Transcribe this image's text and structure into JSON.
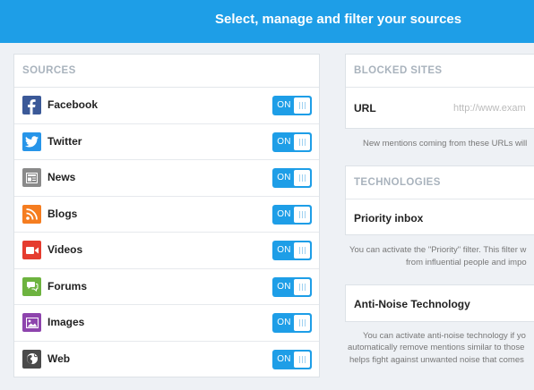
{
  "header": {
    "title": "Select, manage and filter your sources"
  },
  "sources": {
    "heading": "SOURCES",
    "items": [
      {
        "label": "Facebook",
        "icon": "facebook-icon",
        "color": "#3b5998",
        "state": "ON"
      },
      {
        "label": "Twitter",
        "icon": "twitter-icon",
        "color": "#2795e9",
        "state": "ON"
      },
      {
        "label": "News",
        "icon": "news-icon",
        "color": "#8a8a8a",
        "state": "ON"
      },
      {
        "label": "Blogs",
        "icon": "blogs-icon",
        "color": "#f57d20",
        "state": "ON"
      },
      {
        "label": "Videos",
        "icon": "videos-icon",
        "color": "#e53c2f",
        "state": "ON"
      },
      {
        "label": "Forums",
        "icon": "forums-icon",
        "color": "#6db33f",
        "state": "ON"
      },
      {
        "label": "Images",
        "icon": "images-icon",
        "color": "#8e44ad",
        "state": "ON"
      },
      {
        "label": "Web",
        "icon": "web-icon",
        "color": "#4a4a4a",
        "state": "ON"
      }
    ]
  },
  "blocked_sites": {
    "heading": "BLOCKED SITES",
    "url_label": "URL",
    "url_placeholder": "http://www.exam",
    "note": "New mentions coming from these URLs will"
  },
  "technologies": {
    "heading": "TECHNOLOGIES",
    "priority_label": "Priority inbox",
    "priority_note_1": "You can activate the \"Priority\" filter. This filter w",
    "priority_note_2": "from influential people and impo"
  },
  "anti_noise": {
    "label": "Anti-Noise Technology",
    "note_1": "You can activate anti-noise technology if yo",
    "note_2": "automatically remove mentions similar to those",
    "note_3": "helps fight against unwanted noise that comes"
  },
  "colors": {
    "accent": "#1e9ee7",
    "background": "#eef1f5"
  }
}
